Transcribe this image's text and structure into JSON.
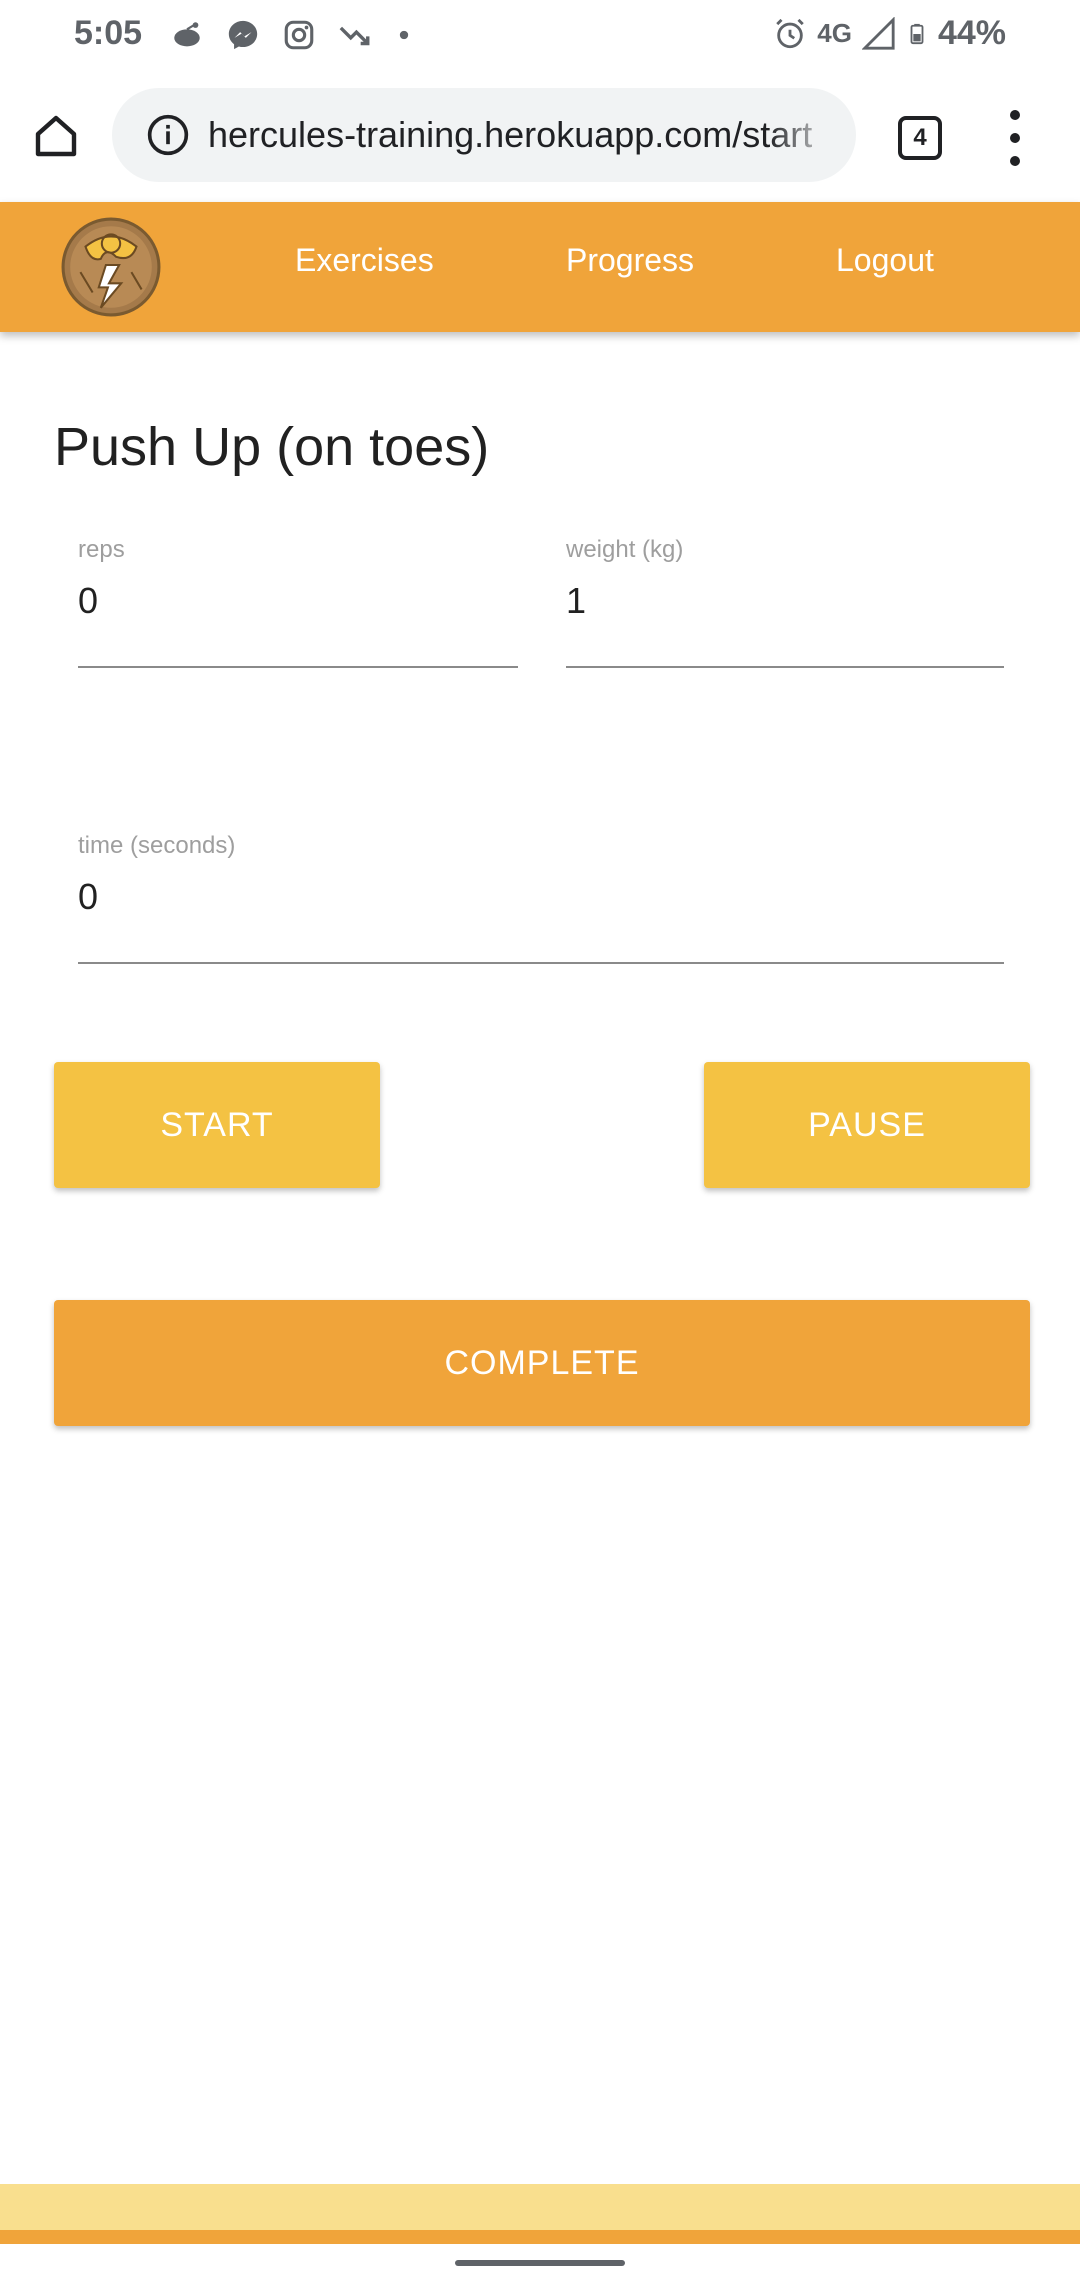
{
  "status_bar": {
    "time": "5:05",
    "left_icons": [
      "reddit-icon",
      "messenger-icon",
      "instagram-icon",
      "trending-down-icon",
      "dot-icon"
    ],
    "right_icons": [
      "alarm-icon",
      "signal-icon",
      "battery-icon"
    ],
    "network": "4G",
    "battery": "44%"
  },
  "browser": {
    "url": "hercules-training.herokuapp.com/start",
    "tab_count": "4"
  },
  "nav": {
    "links": [
      "Exercises",
      "Progress",
      "Logout"
    ]
  },
  "page": {
    "title": "Push Up (on toes)",
    "fields": {
      "reps": {
        "label": "reps",
        "value": "0"
      },
      "weight": {
        "label": "weight (kg)",
        "value": "1"
      },
      "time": {
        "label": "time (seconds)",
        "value": "0"
      }
    },
    "buttons": {
      "start": "START",
      "pause": "PAUSE",
      "complete": "COMPLETE"
    }
  },
  "colors": {
    "primary_orange": "#f0a43a",
    "button_yellow": "#f4c243",
    "footer_light": "#f9df8e"
  }
}
